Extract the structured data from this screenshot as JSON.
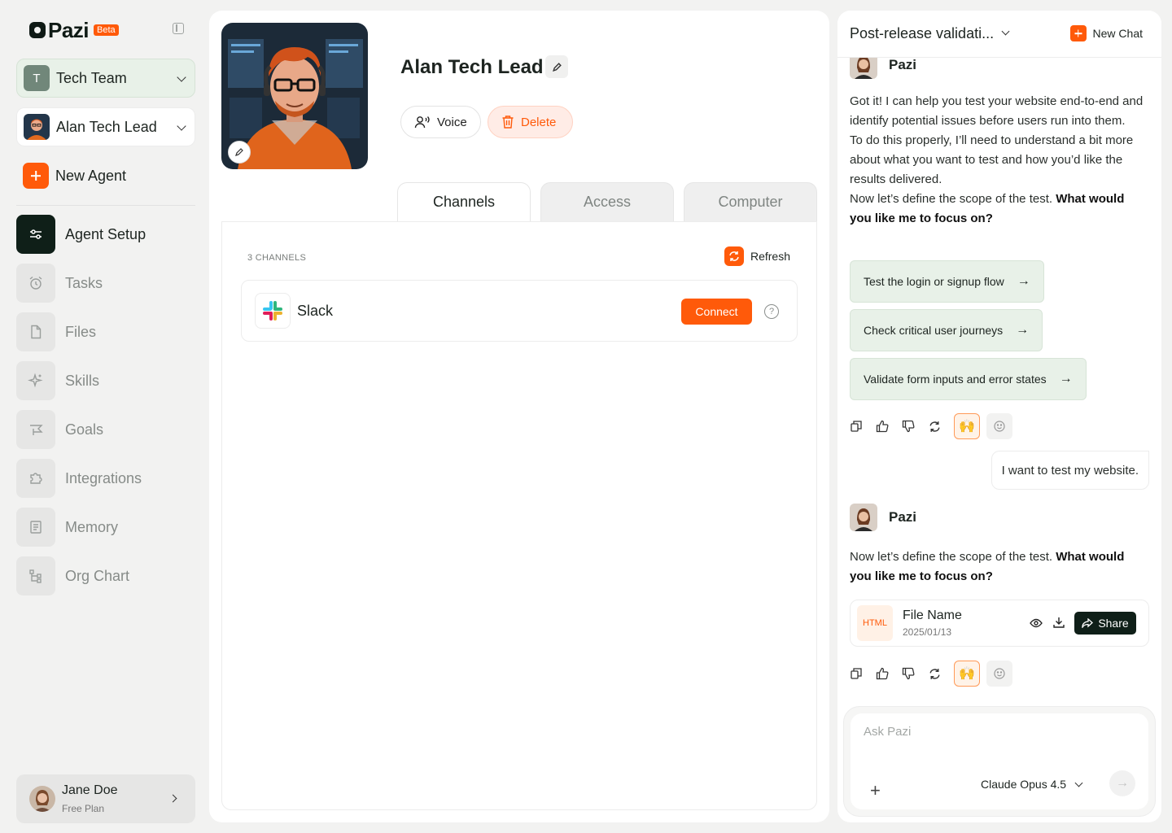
{
  "app": {
    "logo": "Pazi",
    "badge": "Beta"
  },
  "sidebar": {
    "team": {
      "initial": "T",
      "name": "Tech Team"
    },
    "agent": {
      "name": "Alan Tech Lead"
    },
    "new_agent_label": "New Agent",
    "nav": [
      {
        "label": "Agent Setup",
        "icon": "sliders-icon",
        "active": true
      },
      {
        "label": "Tasks",
        "icon": "alarm-clock-icon"
      },
      {
        "label": "Files",
        "icon": "file-icon"
      },
      {
        "label": "Skills",
        "icon": "sparkle-icon"
      },
      {
        "label": "Goals",
        "icon": "flag-icon"
      },
      {
        "label": "Integrations",
        "icon": "puzzle-icon"
      },
      {
        "label": "Memory",
        "icon": "notebook-icon"
      },
      {
        "label": "Org Chart",
        "icon": "hierarchy-icon"
      }
    ],
    "user": {
      "name": "Jane Doe",
      "plan": "Free Plan"
    }
  },
  "agent": {
    "name": "Alan Tech Lead",
    "voice_label": "Voice",
    "delete_label": "Delete"
  },
  "tabs": [
    {
      "label": "Channels",
      "active": true
    },
    {
      "label": "Access"
    },
    {
      "label": "Computer"
    }
  ],
  "channels": {
    "count_label": "3 CHANNELS",
    "refresh_label": "Refresh",
    "items": [
      {
        "name": "Slack",
        "action": "Connect"
      }
    ]
  },
  "chat": {
    "title": "Post-release validati...",
    "new_chat_label": "New Chat",
    "assistant_name": "Pazi",
    "msg1": {
      "p1": "Got it! I can help you test your website end-to-end and identify potential issues before users run into them.",
      "p2": "To do this properly, I’ll need to understand a bit more about what you want to test and how you’d like the results delivered.",
      "p3_plain": "Now let’s define the scope of the test. ",
      "p3_bold": "What would you like me to focus on?"
    },
    "suggestions": [
      "Test the login or signup flow",
      "Check critical user journeys",
      "Validate form inputs and error states"
    ],
    "user_message": "I want to test my website.",
    "msg2": {
      "plain": "Now let’s define the scope of the test. ",
      "bold": "What would you like me to focus on?"
    },
    "file": {
      "type": "HTML",
      "name": "File Name",
      "date": "2025/01/13",
      "share_label": "Share"
    },
    "reaction": "🙌",
    "composer": {
      "placeholder": "Ask Pazi",
      "model": "Claude Opus 4.5"
    }
  },
  "colors": {
    "accent": "#ff5a0a",
    "dark": "#0f1f18",
    "suggestion_bg": "#e8f1e8"
  }
}
